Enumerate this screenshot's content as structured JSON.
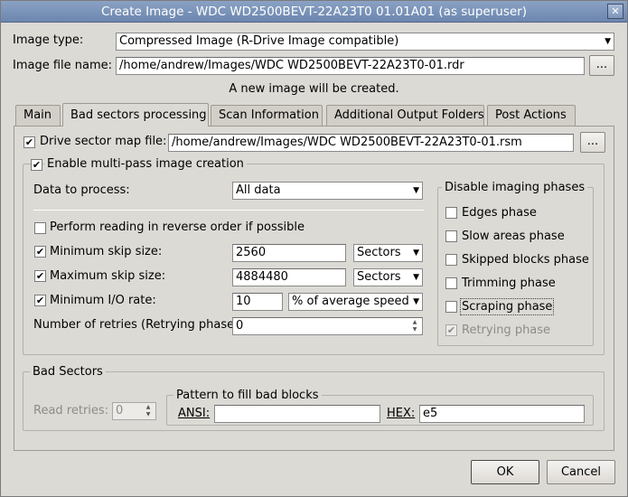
{
  "window": {
    "title": "Create Image - WDC WD2500BEVT-22A23T0 01.01A01 (as superuser)",
    "close_glyph": "✕"
  },
  "image_type": {
    "label": "Image type:",
    "value": "Compressed Image (R-Drive Image compatible)"
  },
  "image_file": {
    "label": "Image file name:",
    "value": "/home/andrew/Images/WDC WD2500BEVT-22A23T0-01.rdr",
    "browse": "..."
  },
  "status": "A new image will be created.",
  "tabs": [
    "Main",
    "Bad sectors processing",
    "Scan Information",
    "Additional Output Folders",
    "Post Actions"
  ],
  "active_tab": 1,
  "drive_map": {
    "label": "Drive sector map file:",
    "checked": true,
    "value": "/home/andrew/Images/WDC WD2500BEVT-22A23T0-01.rsm",
    "browse": "..."
  },
  "multipass": {
    "label": "Enable multi-pass image creation",
    "checked": true,
    "data_to_process": {
      "label": "Data to process:",
      "value": "All data"
    },
    "reverse": {
      "label": "Perform reading in reverse order if possible",
      "checked": false
    },
    "min_skip": {
      "label": "Minimum skip size:",
      "checked": true,
      "value": "2560",
      "unit": "Sectors"
    },
    "max_skip": {
      "label": "Maximum skip size:",
      "checked": true,
      "value": "4884480",
      "unit": "Sectors"
    },
    "min_io": {
      "label": "Minimum I/O rate:",
      "checked": true,
      "value": "10",
      "unit": "% of average speed"
    },
    "retries": {
      "label": "Number of retries (Retrying phase):",
      "value": "0"
    }
  },
  "phases": {
    "title": "Disable imaging phases",
    "items": [
      {
        "label": "Edges phase",
        "checked": false,
        "disabled": false
      },
      {
        "label": "Slow areas phase",
        "checked": false,
        "disabled": false
      },
      {
        "label": "Skipped blocks phase",
        "checked": false,
        "disabled": false
      },
      {
        "label": "Trimming phase",
        "checked": false,
        "disabled": false
      },
      {
        "label": "Scraping phase",
        "checked": false,
        "disabled": false
      },
      {
        "label": "Retrying phase",
        "checked": true,
        "disabled": true
      }
    ]
  },
  "bad_sectors": {
    "title": "Bad Sectors",
    "read_retries": {
      "label": "Read retries:",
      "value": "0"
    },
    "pattern": {
      "title": "Pattern to fill bad blocks",
      "ansi_label": "ANSI:",
      "ansi_value": "",
      "hex_label": "HEX:",
      "hex_value": "e5"
    }
  },
  "buttons": {
    "ok": "OK",
    "cancel": "Cancel"
  }
}
